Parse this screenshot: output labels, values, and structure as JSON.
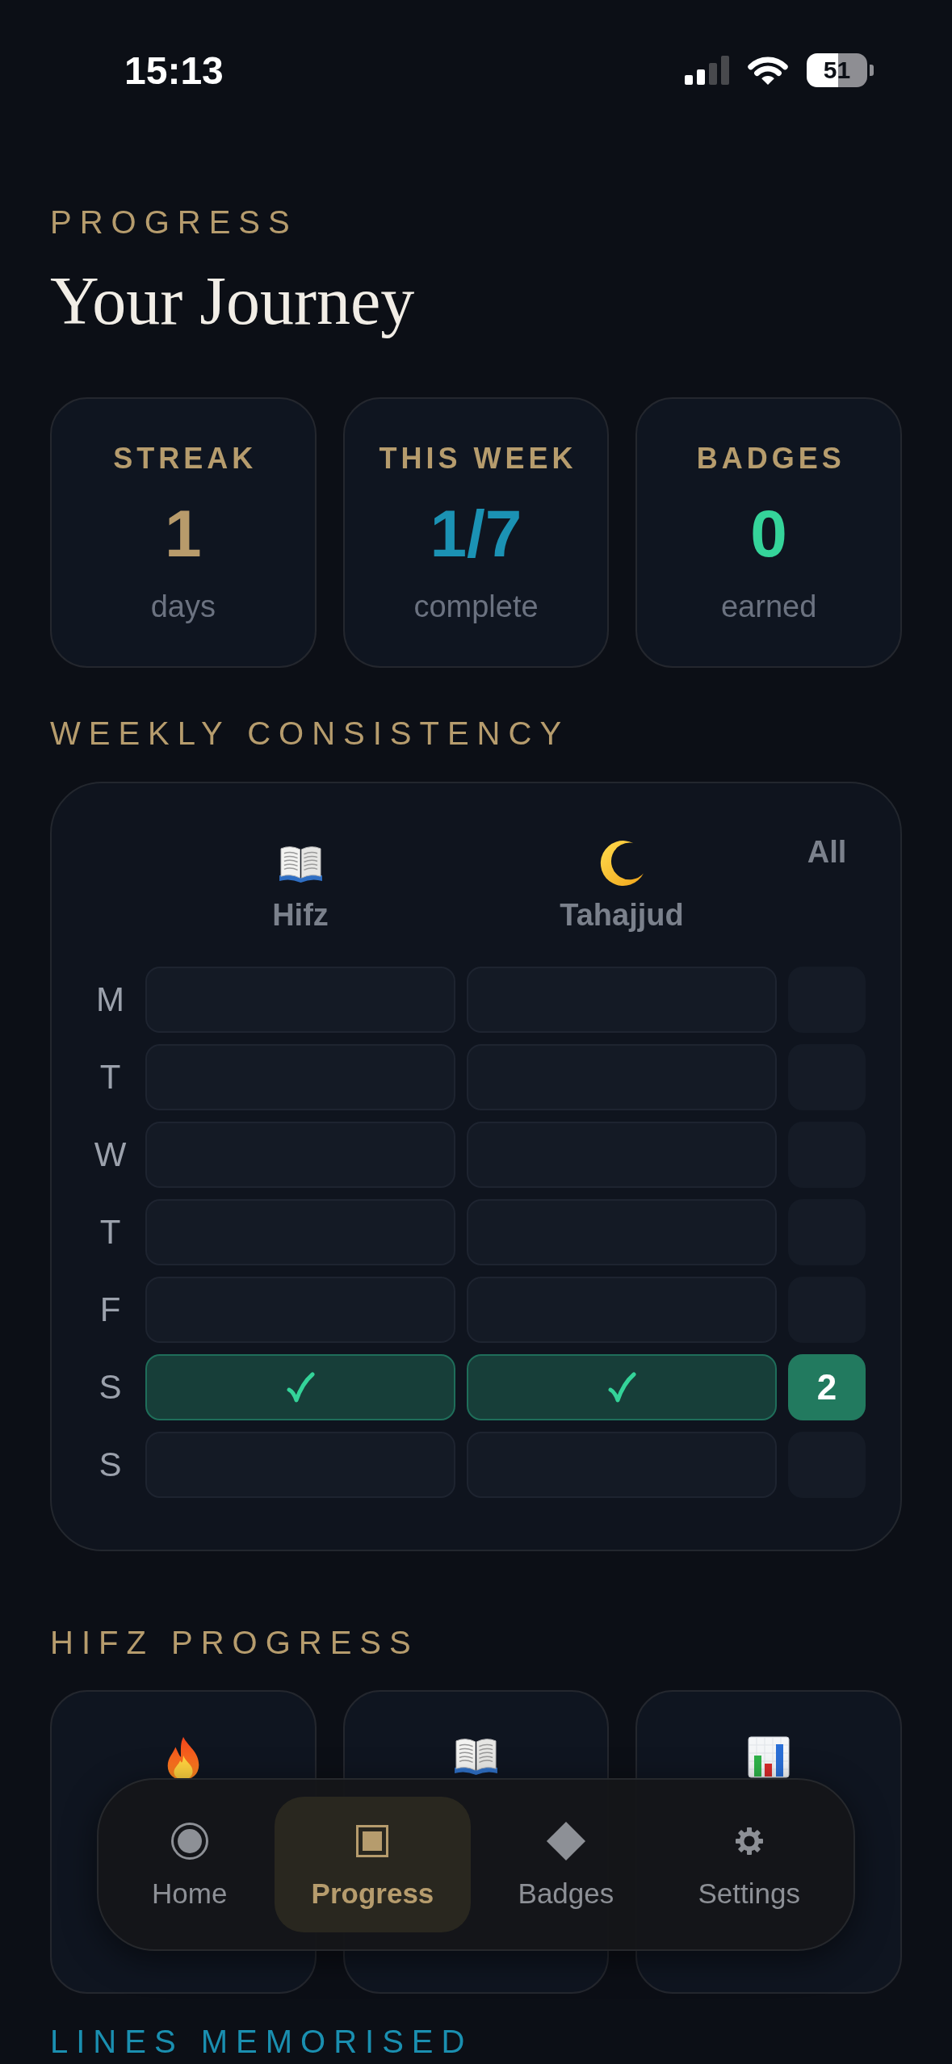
{
  "status_bar": {
    "time": "15:13",
    "battery": "51"
  },
  "header": {
    "eyebrow": "PROGRESS",
    "title": "Your Journey"
  },
  "stats": [
    {
      "label": "STREAK",
      "value": "1",
      "unit": "days",
      "color": "#b89b6b"
    },
    {
      "label": "THIS WEEK",
      "value": "1/7",
      "unit": "complete",
      "color": "#1b92b4"
    },
    {
      "label": "BADGES",
      "value": "0",
      "unit": "earned",
      "color": "#35d49a"
    }
  ],
  "weekly_consistency": {
    "title": "WEEKLY CONSISTENCY",
    "columns": [
      {
        "label": "Hifz"
      },
      {
        "label": "Tahajjud"
      }
    ],
    "total_label": "All",
    "days": [
      {
        "day": "M",
        "cells": [
          {
            "done": false
          },
          {
            "done": false
          }
        ]
      },
      {
        "day": "T",
        "cells": [
          {
            "done": false
          },
          {
            "done": false
          }
        ]
      },
      {
        "day": "W",
        "cells": [
          {
            "done": false
          },
          {
            "done": false
          }
        ]
      },
      {
        "day": "T",
        "cells": [
          {
            "done": false
          },
          {
            "done": false
          }
        ]
      },
      {
        "day": "F",
        "cells": [
          {
            "done": false
          },
          {
            "done": false
          }
        ]
      },
      {
        "day": "S",
        "cells": [
          {
            "done": true
          },
          {
            "done": true
          }
        ],
        "total": "2"
      },
      {
        "day": "S",
        "cells": [
          {
            "done": false
          },
          {
            "done": false
          }
        ]
      }
    ]
  },
  "hifz_progress": {
    "title": "HIFZ PROGRESS",
    "cards": [
      {
        "kind": "flame"
      },
      {
        "kind": "book"
      },
      {
        "kind": "chart"
      }
    ]
  },
  "lines_memorised": {
    "title": "LINES MEMORISED"
  },
  "tab_bar": [
    {
      "label": "Home",
      "selected": false
    },
    {
      "label": "Progress",
      "selected": true
    },
    {
      "label": "Badges",
      "selected": false
    },
    {
      "label": "Settings",
      "selected": false
    }
  ]
}
